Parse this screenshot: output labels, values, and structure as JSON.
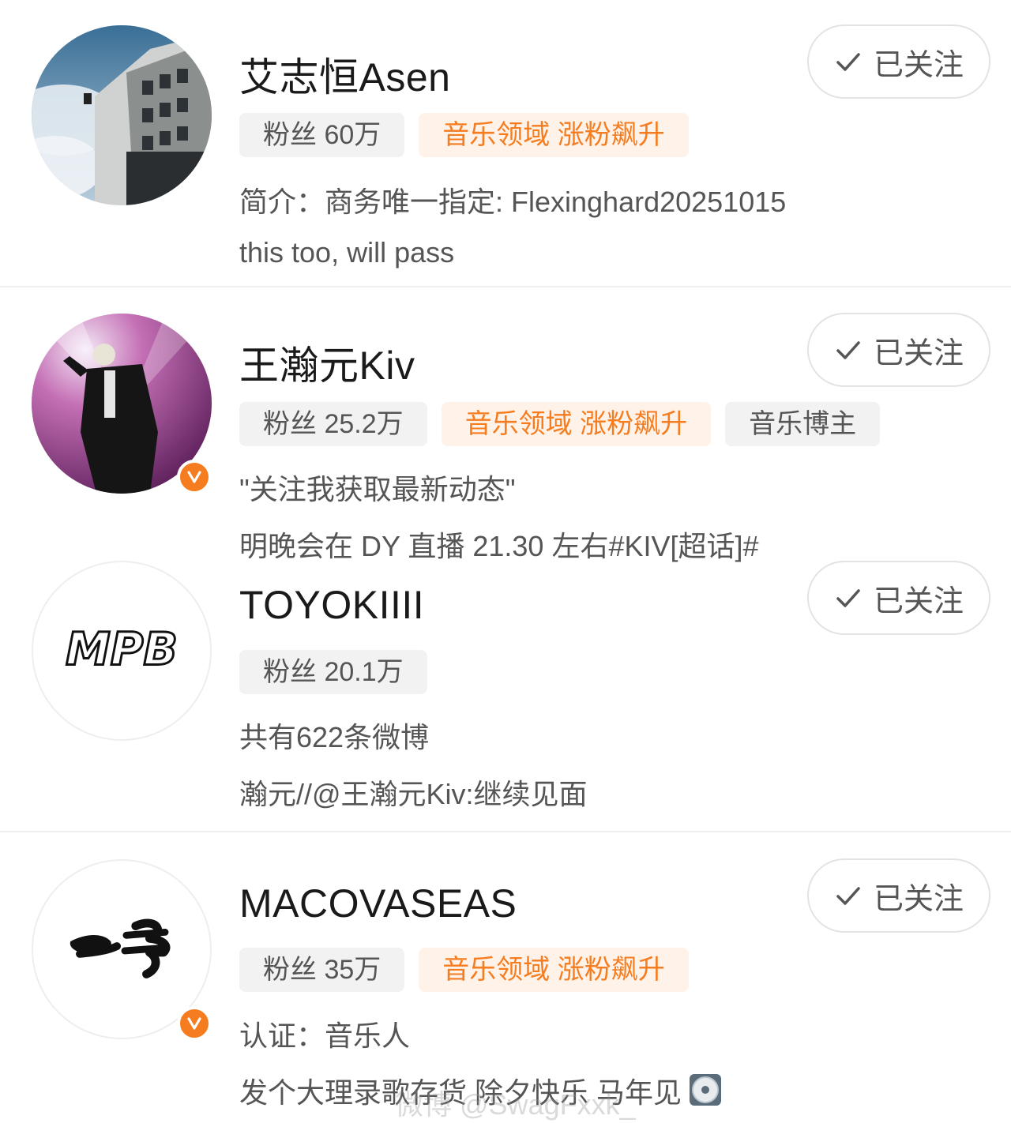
{
  "follow_label": "已关注",
  "accent_color": "#f57c1f",
  "users": [
    {
      "name": "艾志恒Asen",
      "fans": "粉丝 60万",
      "tags": [
        "音乐领域 涨粉飙升"
      ],
      "line1": "简介：商务唯一指定: Flexinghard20251015",
      "line2": "this too, will pass"
    },
    {
      "name": "王瀚元Kiv",
      "fans": "粉丝 25.2万",
      "tags": [
        "音乐领域 涨粉飙升",
        "音乐博主"
      ],
      "line1": "\"关注我获取最新动态\"",
      "line2": "明晚会在 DY 直播 21.30 左右#KIV[超话]#",
      "verified": true
    },
    {
      "name": "TOYOKIIII",
      "fans": "粉丝 20.1万",
      "tags": [],
      "line1": "共有622条微博",
      "line2": "瀚元//@王瀚元Kiv:继续见面",
      "avatar_logo": "MPB"
    },
    {
      "name": "MACOVASEAS",
      "fans": "粉丝 35万",
      "tags": [
        "音乐领域 涨粉飙升"
      ],
      "line1": "认证：音乐人",
      "line2": "发个大理录歌存货 除夕快乐 马年见",
      "verified": true
    }
  ],
  "watermark": "微博 @SwagFxxk_"
}
